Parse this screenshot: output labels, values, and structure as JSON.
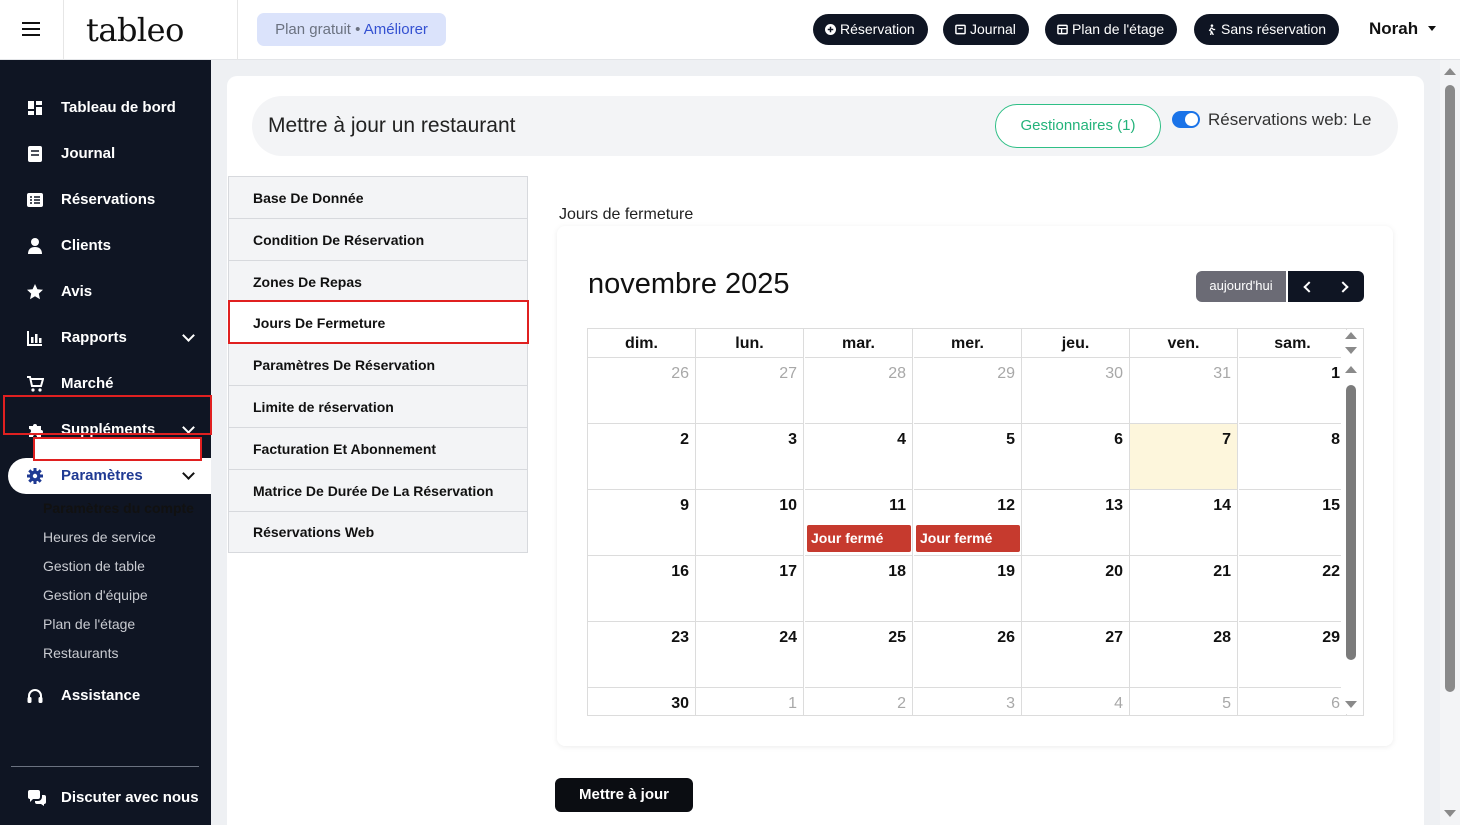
{
  "topbar": {
    "logo": "tableo",
    "plan": "Plan gratuit",
    "plan_sep": " • ",
    "upgrade": "Améliorer",
    "buttons": [
      {
        "label": "Réservation",
        "icon": "plus-circle-icon"
      },
      {
        "label": "Journal",
        "icon": "book-icon"
      },
      {
        "label": "Plan de l'étage",
        "icon": "floorplan-icon"
      },
      {
        "label": "Sans réservation",
        "icon": "walk-in-icon"
      }
    ],
    "user": "Norah"
  },
  "sidebar": {
    "items": [
      {
        "label": "Tableau de bord",
        "icon": "dashboard-icon"
      },
      {
        "label": "Journal",
        "icon": "book-icon"
      },
      {
        "label": "Réservations",
        "icon": "list-icon"
      },
      {
        "label": "Clients",
        "icon": "user-icon"
      },
      {
        "label": "Avis",
        "icon": "star-icon"
      },
      {
        "label": "Rapports",
        "icon": "chart-icon",
        "expandable": true
      },
      {
        "label": "Marché",
        "icon": "cart-icon"
      },
      {
        "label": "Suppléments",
        "icon": "puzzle-icon",
        "expandable": true
      },
      {
        "label": "Paramètres",
        "icon": "gear-icon",
        "expandable": true,
        "active": true
      },
      {
        "label": "Assistance",
        "icon": "headset-icon"
      }
    ],
    "sub_items": [
      "Paramètres du compte",
      "Heures de service",
      "Gestion de table",
      "Gestion d'équipe",
      "Plan de l'étage",
      "Restaurants"
    ],
    "chat": "Discuter avec nous"
  },
  "header": {
    "title": "Mettre à jour un restaurant",
    "managers": "Gestionnaires (1)",
    "web_reservations": "Réservations web: Le"
  },
  "settings_menu": [
    "Base De Donnée",
    "Condition De Réservation",
    "Zones De Repas",
    "Jours De Fermeture",
    "Paramètres De Réservation",
    "Limite de réservation",
    "Facturation Et Abonnement",
    "Matrice De Durée De La Réservation",
    "Réservations Web"
  ],
  "settings_active_index": 3,
  "calendar": {
    "section_title": "Jours de fermeture",
    "month": "novembre 2025",
    "today_label": "aujourd'hui",
    "weekdays": [
      "dim.",
      "lun.",
      "mar.",
      "mer.",
      "jeu.",
      "ven.",
      "sam."
    ],
    "weeks": [
      [
        "26",
        "27",
        "28",
        "29",
        "30",
        "31",
        "1"
      ],
      [
        "2",
        "3",
        "4",
        "5",
        "6",
        "7",
        "8"
      ],
      [
        "9",
        "10",
        "11",
        "12",
        "13",
        "14",
        "15"
      ],
      [
        "16",
        "17",
        "18",
        "19",
        "20",
        "21",
        "22"
      ],
      [
        "23",
        "24",
        "25",
        "26",
        "27",
        "28",
        "29"
      ],
      [
        "30",
        "1",
        "2",
        "3",
        "4",
        "5",
        "6"
      ]
    ],
    "today": "7",
    "events": [
      {
        "day": "11",
        "label": "Jour fermé"
      },
      {
        "day": "12",
        "label": "Jour fermé"
      }
    ]
  },
  "update_button": "Mettre à jour",
  "colors": {
    "sidebar": "#0f1523",
    "accent_green": "#2fbf86",
    "toggle_blue": "#1a73e8",
    "closed_day": "#c63a2e",
    "highlight_red": "#e02020",
    "today_bg": "#fdf6dc"
  }
}
